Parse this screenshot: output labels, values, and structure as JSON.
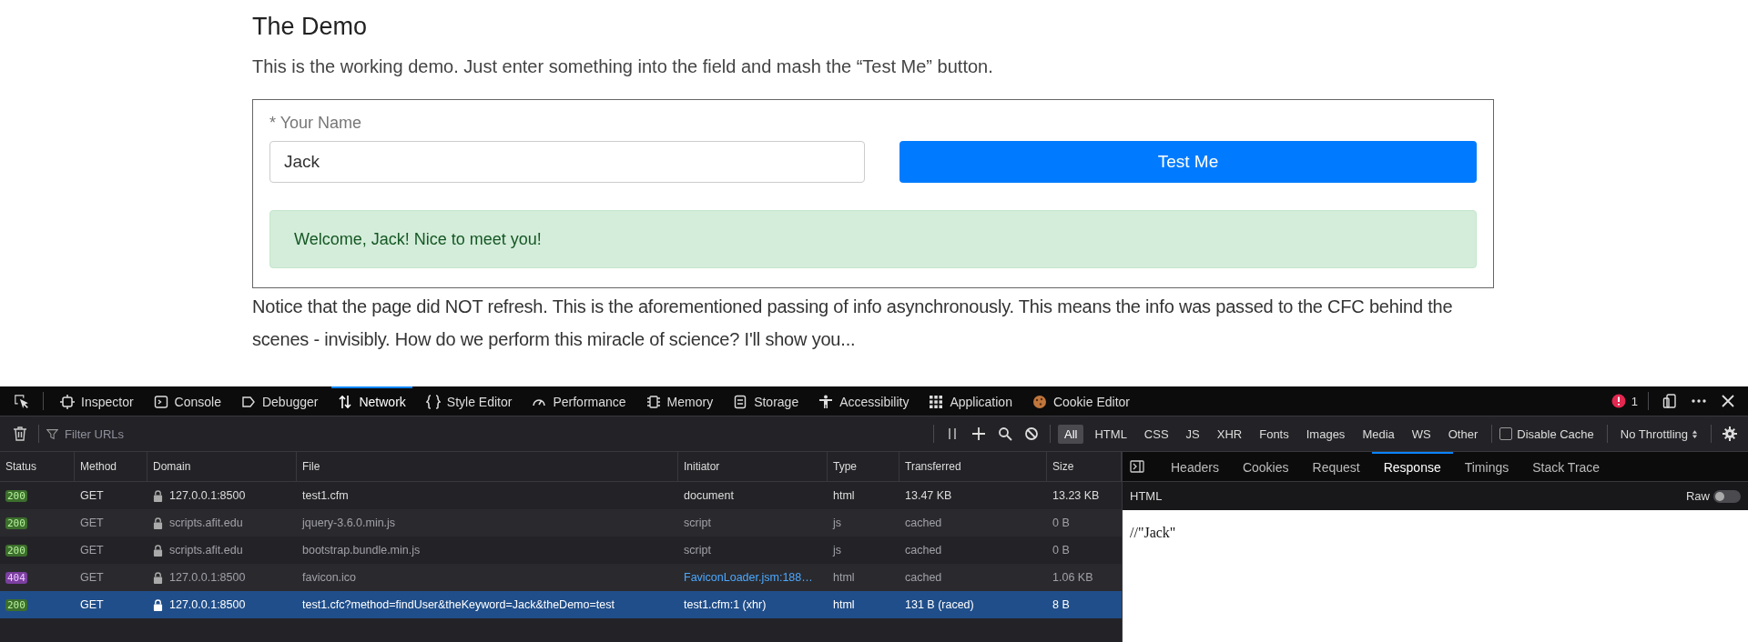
{
  "page": {
    "heading": "The Demo",
    "intro": "This is the working demo. Just enter something into the field and mash the “Test Me” button.",
    "form": {
      "label": "* Your Name",
      "value": "Jack",
      "button": "Test Me",
      "alert": "Welcome, Jack! Nice to meet you!"
    },
    "outro": "Notice that the page did NOT refresh. This is the aforementioned passing of info asynchronously. This means the info was passed to the CFC behind the scenes - invisibly. How do we perform this miracle of science? I'll show you..."
  },
  "devtools": {
    "tabs": [
      {
        "label": "Inspector",
        "selected": false
      },
      {
        "label": "Console",
        "selected": false
      },
      {
        "label": "Debugger",
        "selected": false
      },
      {
        "label": "Network",
        "selected": true
      },
      {
        "label": "Style Editor",
        "selected": false
      },
      {
        "label": "Performance",
        "selected": false
      },
      {
        "label": "Memory",
        "selected": false
      },
      {
        "label": "Storage",
        "selected": false
      },
      {
        "label": "Accessibility",
        "selected": false
      },
      {
        "label": "Application",
        "selected": false
      },
      {
        "label": "Cookie Editor",
        "selected": false
      }
    ],
    "error_count": "1",
    "filter": {
      "placeholder": "Filter URLs"
    },
    "type_filters": [
      {
        "label": "All",
        "selected": true
      },
      {
        "label": "HTML",
        "selected": false
      },
      {
        "label": "CSS",
        "selected": false
      },
      {
        "label": "JS",
        "selected": false
      },
      {
        "label": "XHR",
        "selected": false
      },
      {
        "label": "Fonts",
        "selected": false
      },
      {
        "label": "Images",
        "selected": false
      },
      {
        "label": "Media",
        "selected": false
      },
      {
        "label": "WS",
        "selected": false
      },
      {
        "label": "Other",
        "selected": false
      }
    ],
    "disable_cache": {
      "label": "Disable Cache",
      "checked": false
    },
    "throttling": "No Throttling",
    "table": {
      "columns": [
        "Status",
        "Method",
        "Domain",
        "File",
        "Initiator",
        "Type",
        "Transferred",
        "Size"
      ],
      "rows": [
        {
          "status": "200",
          "method": "GET",
          "domain": "127.0.0.1:8500",
          "file": "test1.cfm",
          "initiator": "document",
          "initiator_link": false,
          "type": "html",
          "transferred": "13.47 KB",
          "size": "13.23 KB",
          "dimmed": false,
          "selected": false
        },
        {
          "status": "200",
          "method": "GET",
          "domain": "scripts.afit.edu",
          "file": "jquery-3.6.0.min.js",
          "initiator": "script",
          "initiator_link": false,
          "type": "js",
          "transferred": "cached",
          "size": "0 B",
          "dimmed": true,
          "selected": false
        },
        {
          "status": "200",
          "method": "GET",
          "domain": "scripts.afit.edu",
          "file": "bootstrap.bundle.min.js",
          "initiator": "script",
          "initiator_link": false,
          "type": "js",
          "transferred": "cached",
          "size": "0 B",
          "dimmed": true,
          "selected": false
        },
        {
          "status": "404",
          "method": "GET",
          "domain": "127.0.0.1:8500",
          "file": "favicon.ico",
          "initiator": "FaviconLoader.jsm:188…",
          "initiator_link": true,
          "type": "html",
          "transferred": "cached",
          "size": "1.06 KB",
          "dimmed": true,
          "selected": false
        },
        {
          "status": "200",
          "method": "GET",
          "domain": "127.0.0.1:8500",
          "file": "test1.cfc?method=findUser&theKeyword=Jack&theDemo=test",
          "initiator": "test1.cfm:1 (xhr)",
          "initiator_link": false,
          "type": "html",
          "transferred": "131 B (raced)",
          "size": "8 B",
          "dimmed": false,
          "selected": true
        }
      ]
    },
    "details": {
      "tabs": [
        {
          "label": "Headers",
          "selected": false
        },
        {
          "label": "Cookies",
          "selected": false
        },
        {
          "label": "Request",
          "selected": false
        },
        {
          "label": "Response",
          "selected": true
        },
        {
          "label": "Timings",
          "selected": false
        },
        {
          "label": "Stack Trace",
          "selected": false
        }
      ],
      "format": "HTML",
      "raw": {
        "label": "Raw",
        "on": false
      },
      "body": "//\"Jack\""
    }
  }
}
